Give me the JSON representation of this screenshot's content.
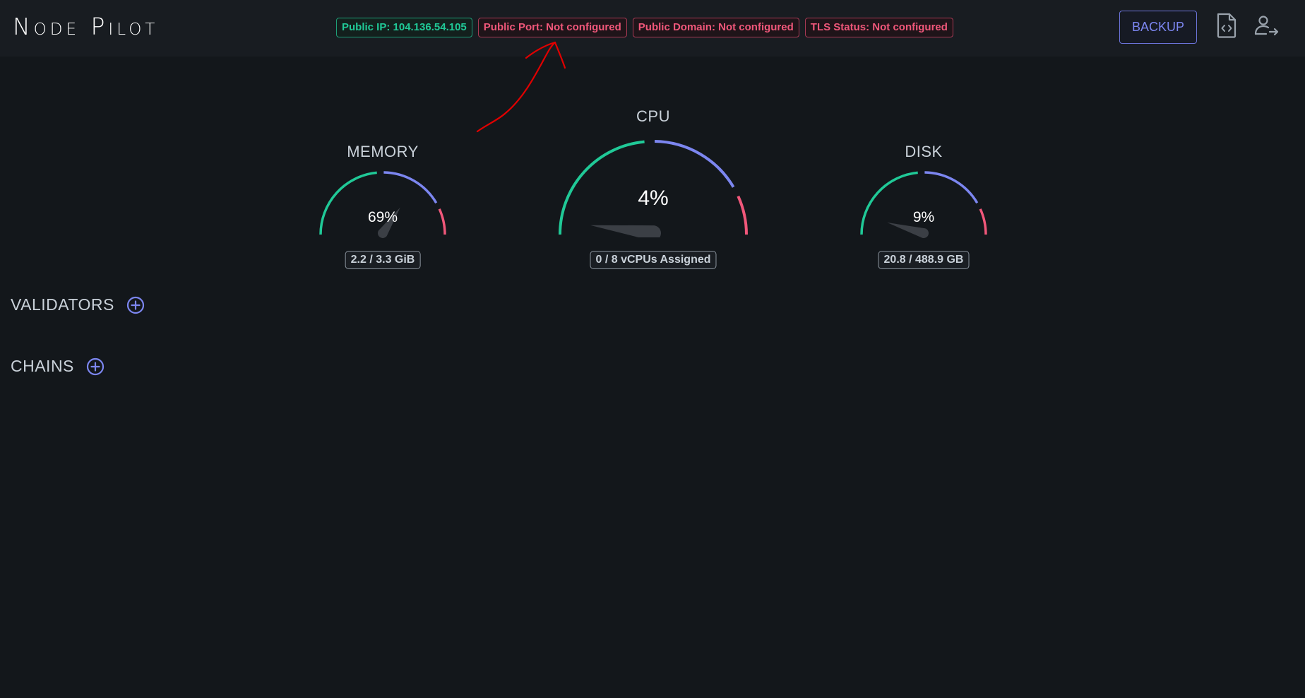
{
  "app": {
    "title": "Node Pilot"
  },
  "header": {
    "badges": [
      {
        "label": "Public IP: 104.136.54.105",
        "status": "ok"
      },
      {
        "label": "Public Port: Not configured",
        "status": "bad"
      },
      {
        "label": "Public Domain: Not configured",
        "status": "bad"
      },
      {
        "label": "TLS Status: Not configured",
        "status": "bad"
      }
    ],
    "backup_label": "BACKUP",
    "icons": [
      "file-code-icon",
      "user-logout-icon"
    ]
  },
  "gauges": {
    "memory": {
      "title": "MEMORY",
      "value": "69%",
      "percent": 69,
      "detail": "2.2 / 3.3 GiB"
    },
    "cpu": {
      "title": "CPU",
      "value": "4%",
      "percent": 4,
      "detail": "0 / 8 vCPUs Assigned"
    },
    "disk": {
      "title": "DISK",
      "value": "9%",
      "percent": 9,
      "detail": "20.8 / 488.9 GB"
    }
  },
  "sections": {
    "validators": {
      "label": "VALIDATORS"
    },
    "chains": {
      "label": "CHAINS"
    }
  },
  "colors": {
    "accent": "#7c86f0",
    "ok": "#20c997",
    "danger": "#f0577a",
    "annotation": "#e00000"
  }
}
